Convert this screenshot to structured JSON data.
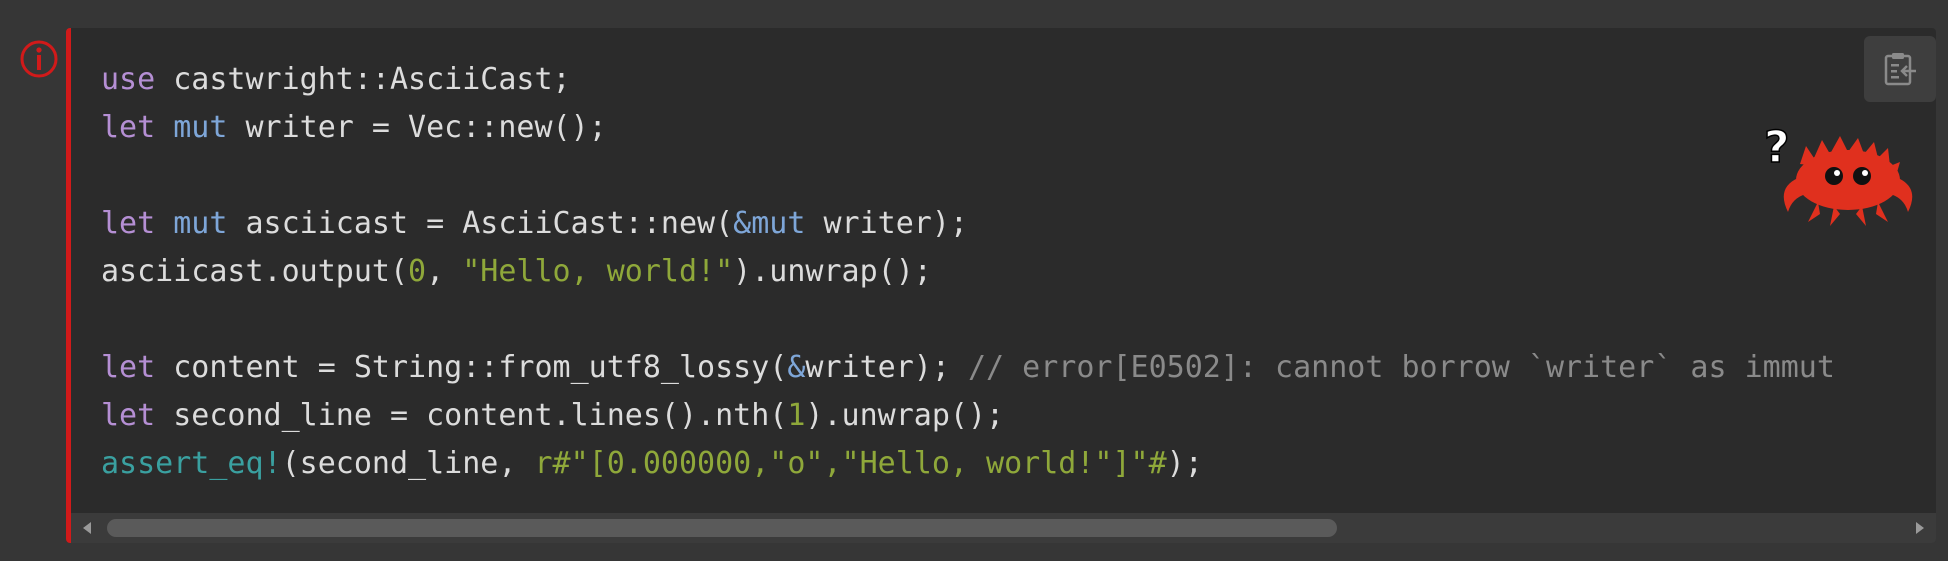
{
  "code_block": {
    "status_icon": "error-info-icon",
    "copy_icon": "clipboard-copy-icon",
    "mascot_icon": "ferris-crab-question-icon",
    "mascot_mark": "?",
    "lines": [
      [
        {
          "t": "use",
          "c": "kw"
        },
        {
          "t": " castwright::AsciiCast;",
          "c": "plain"
        }
      ],
      [
        {
          "t": "let",
          "c": "kw"
        },
        {
          "t": " ",
          "c": "plain"
        },
        {
          "t": "mut",
          "c": "mut"
        },
        {
          "t": " writer = Vec::new();",
          "c": "plain"
        }
      ],
      [],
      [
        {
          "t": "let",
          "c": "kw"
        },
        {
          "t": " ",
          "c": "plain"
        },
        {
          "t": "mut",
          "c": "mut"
        },
        {
          "t": " asciicast = AsciiCast::new(",
          "c": "plain"
        },
        {
          "t": "&mut",
          "c": "amp"
        },
        {
          "t": " writer);",
          "c": "plain"
        }
      ],
      [
        {
          "t": "asciicast.output(",
          "c": "plain"
        },
        {
          "t": "0",
          "c": "num"
        },
        {
          "t": ", ",
          "c": "plain"
        },
        {
          "t": "\"Hello, world!\"",
          "c": "str"
        },
        {
          "t": ").unwrap();",
          "c": "plain"
        }
      ],
      [],
      [
        {
          "t": "let",
          "c": "kw"
        },
        {
          "t": " content = String::from_utf8_lossy(",
          "c": "plain"
        },
        {
          "t": "&",
          "c": "amp"
        },
        {
          "t": "writer); ",
          "c": "plain"
        },
        {
          "t": "// error[E0502]: cannot borrow `writer` as immut",
          "c": "com"
        }
      ],
      [
        {
          "t": "let",
          "c": "kw"
        },
        {
          "t": " second_line = content.lines().nth(",
          "c": "plain"
        },
        {
          "t": "1",
          "c": "num"
        },
        {
          "t": ").unwrap();",
          "c": "plain"
        }
      ],
      [
        {
          "t": "assert_eq!",
          "c": "mac"
        },
        {
          "t": "(second_line, ",
          "c": "plain"
        },
        {
          "t": "r#\"[0.000000,\"o\",\"Hello, world!\"]\"#",
          "c": "str"
        },
        {
          "t": ");",
          "c": "plain"
        }
      ]
    ]
  },
  "scrollbar": {
    "left_icon": "scroll-left-arrow-icon",
    "right_icon": "scroll-right-arrow-icon"
  }
}
